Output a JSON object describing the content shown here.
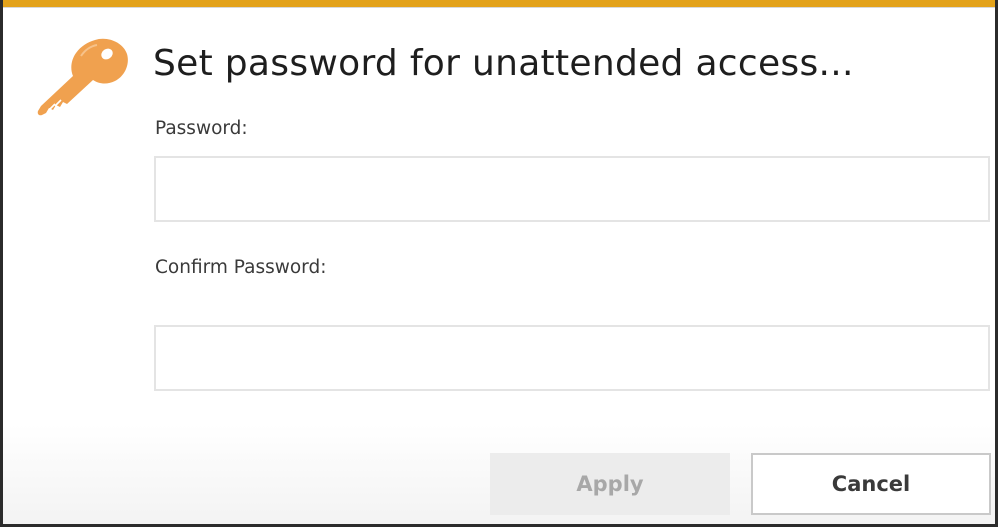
{
  "dialog": {
    "title": "Set password for unattended access...",
    "accent_color": "#e3a21a",
    "icon": "key-icon"
  },
  "form": {
    "password_label": "Password:",
    "password_value": "",
    "confirm_label": "Confirm Password:",
    "confirm_value": ""
  },
  "buttons": {
    "apply_label": "Apply",
    "apply_enabled": false,
    "cancel_label": "Cancel"
  }
}
